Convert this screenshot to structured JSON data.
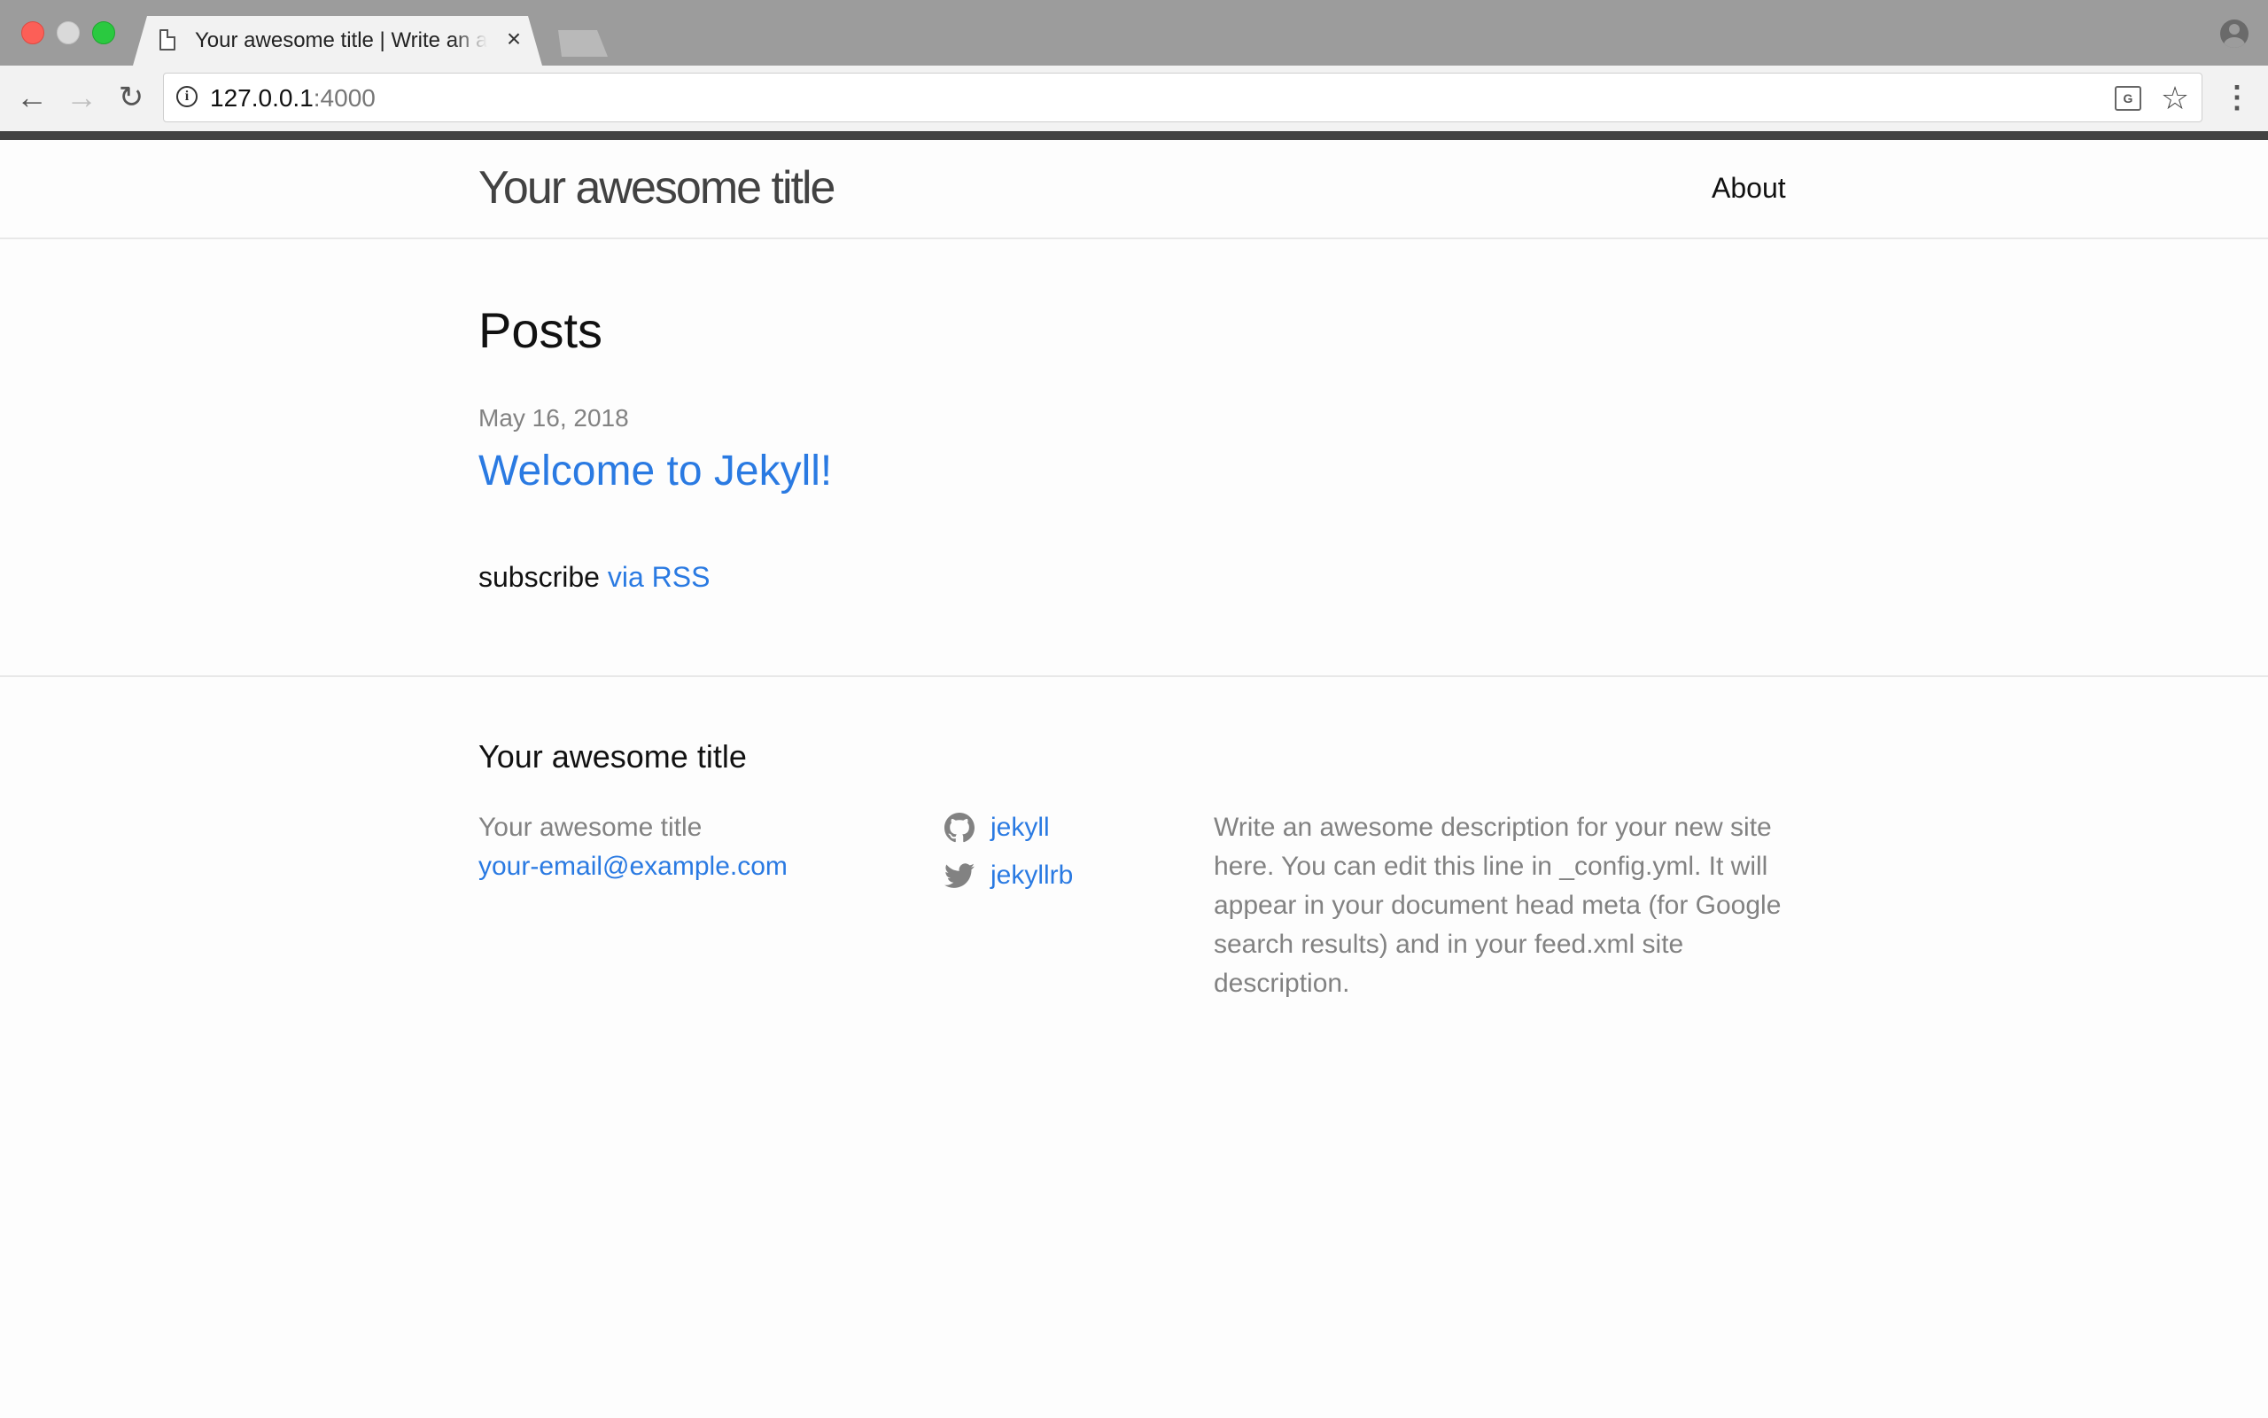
{
  "browser": {
    "tab_title": "Your awesome title | Write an awesome description for your new site",
    "tab_close": "×",
    "url_host": "127.0.0.1",
    "url_port": ":4000",
    "icons": {
      "back": "arrow-left",
      "forward": "arrow-right",
      "reload": "reload",
      "info": "info-circle",
      "translate": "translate",
      "bookmark": "star",
      "menu": "vertical-ellipsis",
      "profile": "person-circle"
    },
    "back_glyph": "←",
    "forward_glyph": "→",
    "reload_glyph": "↻",
    "info_glyph": "i",
    "translate_glyph": "G",
    "star_glyph": "☆",
    "menu_glyph": "⋮"
  },
  "header": {
    "site_title": "Your awesome title",
    "nav_about": "About"
  },
  "main": {
    "heading": "Posts",
    "posts": [
      {
        "date": "May 16, 2018",
        "title": "Welcome to Jekyll!"
      }
    ],
    "subscribe_text": "subscribe",
    "subscribe_link": "via RSS"
  },
  "footer": {
    "heading": "Your awesome title",
    "name": "Your awesome title",
    "email": "your-email@example.com",
    "github_user": "jekyll",
    "twitter_user": "jekyllrb",
    "description": "Write an awesome description for your new site here. You can edit this line in _config.yml. It will appear in your document head meta (for Google search results) and in your feed.xml site description."
  },
  "colors": {
    "link": "#2a7ae2",
    "muted": "#828282",
    "chrome": "#9c9c9c",
    "accent_bar": "#424242"
  }
}
